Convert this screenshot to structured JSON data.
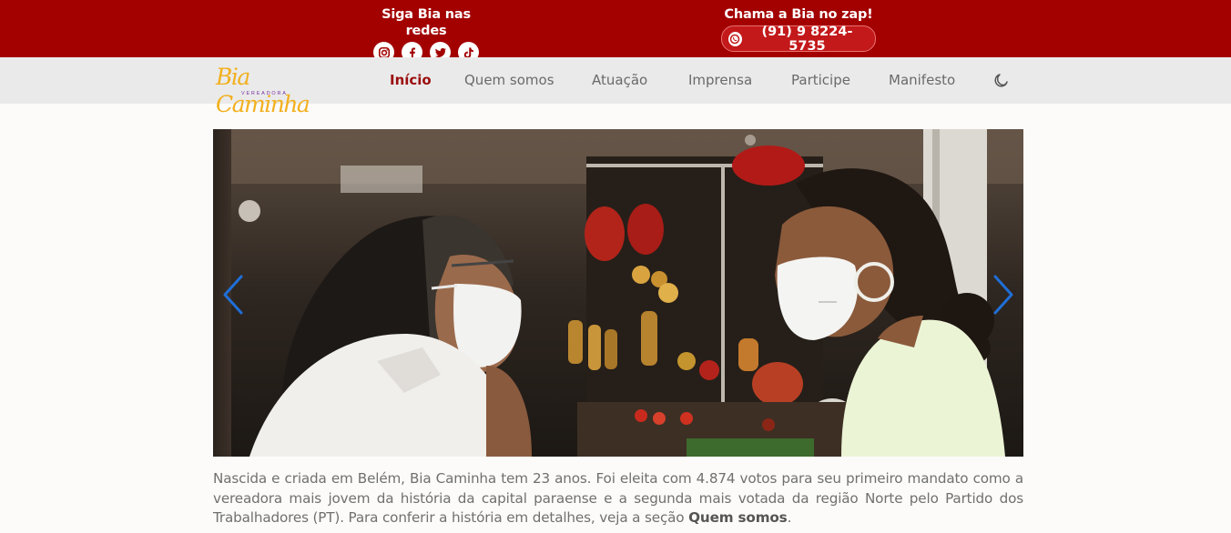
{
  "topbar": {
    "social_title": "Siga Bia nas redes",
    "social_icons": [
      "instagram-icon",
      "facebook-icon",
      "twitter-icon",
      "tiktok-icon"
    ],
    "zap_title": "Chama a Bia no zap!",
    "zap_number": "(91) 9 8224-5735",
    "zap_icon": "whatsapp-icon"
  },
  "nav": {
    "logo_text": "Bia Caminha",
    "logo_subtext": "VEREADORA",
    "items": [
      {
        "label": "Início",
        "active": true
      },
      {
        "label": "Quem somos",
        "active": false
      },
      {
        "label": "Atuação",
        "active": false
      },
      {
        "label": "Imprensa",
        "active": false
      },
      {
        "label": "Participe",
        "active": false
      },
      {
        "label": "Manifesto",
        "active": false
      }
    ],
    "theme_icon": "moon-icon"
  },
  "carousel": {
    "prev_icon": "chevron-left-icon",
    "next_icon": "chevron-right-icon"
  },
  "intro": {
    "text": "Nascida e criada em Belém, Bia Caminha tem 23 anos. Foi eleita com 4.874 votos para seu primeiro mandato como a vereadora mais jovem da história da capital paraense e a segunda mais votada da região Norte pelo Partido dos Trabalhadores (PT). Para conferir a história em detalhes, veja a seção ",
    "link": "Quem somos",
    "end": "."
  },
  "colors": {
    "topbar_bg": "#a30000",
    "nav_bg": "#eaeaea",
    "active_link": "#9b0e0e",
    "logo": "#f2b01e",
    "arrow": "#1f6fd8"
  }
}
